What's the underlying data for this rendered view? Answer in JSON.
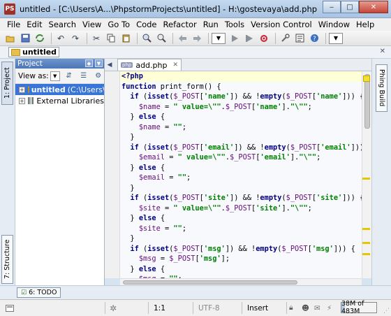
{
  "window": {
    "title": "untitled - [C:\\Users\\A...\\PhpstormProjects\\untitled] - H:\\gostevaya\\add.php - JetBrains PhpStorm ...",
    "app_icon": "PS",
    "controls": {
      "minimize": "‒",
      "maximize": "□",
      "close": "✕"
    }
  },
  "menu": [
    "File",
    "Edit",
    "Search",
    "View",
    "Go To",
    "Code",
    "Refactor",
    "Run",
    "Tools",
    "Version Control",
    "Window",
    "Help"
  ],
  "toolbar": {
    "icons": [
      "open-icon",
      "save-icon",
      "sync-icon",
      "undo-icon",
      "redo-icon",
      "cut-icon",
      "copy-icon",
      "paste-icon",
      "find-icon",
      "replace-icon",
      "back-icon",
      "forward-icon",
      "run-config-dropdown",
      "run-icon",
      "debug-icon",
      "stop-icon",
      "settings-icon",
      "structure-icon",
      "help-icon",
      "more-dropdown"
    ]
  },
  "navbar": {
    "crumb": "untitled"
  },
  "left_strip": {
    "project_tab": "1: Project",
    "structure_tab": "7: Structure"
  },
  "project": {
    "header": "Project",
    "view_as_label": "View as:",
    "tree": [
      {
        "name": "untitled",
        "path": "(C:\\Users\\A",
        "selected": true
      },
      {
        "name": "External Libraries",
        "selected": false
      }
    ]
  },
  "editor": {
    "tab": {
      "icon": "php",
      "label": "add.php"
    },
    "lines": [
      [
        {
          "t": "<?php",
          "c": "tag"
        }
      ],
      [
        {
          "t": "function ",
          "c": "kw"
        },
        {
          "t": "print_form",
          "c": "fn"
        },
        {
          "t": "() {",
          "c": ""
        }
      ],
      [
        {
          "t": "  if ",
          "c": "kw"
        },
        {
          "t": "(",
          "c": ""
        },
        {
          "t": "isset",
          "c": "kw"
        },
        {
          "t": "(",
          "c": ""
        },
        {
          "t": "$_POST",
          "c": "var"
        },
        {
          "t": "[",
          "c": ""
        },
        {
          "t": "'name'",
          "c": "str"
        },
        {
          "t": "]) && !",
          "c": ""
        },
        {
          "t": "empty",
          "c": "kw"
        },
        {
          "t": "(",
          "c": ""
        },
        {
          "t": "$_POST",
          "c": "var"
        },
        {
          "t": "[",
          "c": ""
        },
        {
          "t": "'name'",
          "c": "str"
        },
        {
          "t": "])) {",
          "c": ""
        }
      ],
      [
        {
          "t": "    ",
          "c": ""
        },
        {
          "t": "$name",
          "c": "var"
        },
        {
          "t": " = ",
          "c": ""
        },
        {
          "t": "\" value=\\\"\"",
          "c": "str"
        },
        {
          "t": ".",
          "c": ""
        },
        {
          "t": "$_POST",
          "c": "var"
        },
        {
          "t": "[",
          "c": ""
        },
        {
          "t": "'name'",
          "c": "str"
        },
        {
          "t": "].",
          "c": ""
        },
        {
          "t": "\"\\\"\"",
          "c": "str"
        },
        {
          "t": ";",
          "c": ""
        }
      ],
      [
        {
          "t": "  } ",
          "c": ""
        },
        {
          "t": "else",
          "c": "kw"
        },
        {
          "t": " {",
          "c": ""
        }
      ],
      [
        {
          "t": "    ",
          "c": ""
        },
        {
          "t": "$name",
          "c": "var"
        },
        {
          "t": " = ",
          "c": ""
        },
        {
          "t": "\"\"",
          "c": "str"
        },
        {
          "t": ";",
          "c": ""
        }
      ],
      [
        {
          "t": "  }",
          "c": ""
        }
      ],
      [
        {
          "t": "  if ",
          "c": "kw"
        },
        {
          "t": "(",
          "c": ""
        },
        {
          "t": "isset",
          "c": "kw"
        },
        {
          "t": "(",
          "c": ""
        },
        {
          "t": "$_POST",
          "c": "var"
        },
        {
          "t": "[",
          "c": ""
        },
        {
          "t": "'email'",
          "c": "str"
        },
        {
          "t": "]) && !",
          "c": ""
        },
        {
          "t": "empty",
          "c": "kw"
        },
        {
          "t": "(",
          "c": ""
        },
        {
          "t": "$_POST",
          "c": "var"
        },
        {
          "t": "[",
          "c": ""
        },
        {
          "t": "'email'",
          "c": "str"
        },
        {
          "t": "])) {",
          "c": ""
        }
      ],
      [
        {
          "t": "    ",
          "c": ""
        },
        {
          "t": "$email",
          "c": "var"
        },
        {
          "t": " = ",
          "c": ""
        },
        {
          "t": "\" value=\\\"\"",
          "c": "str"
        },
        {
          "t": ".",
          "c": ""
        },
        {
          "t": "$_POST",
          "c": "var"
        },
        {
          "t": "[",
          "c": ""
        },
        {
          "t": "'email'",
          "c": "str"
        },
        {
          "t": "].",
          "c": ""
        },
        {
          "t": "\"\\\"\"",
          "c": "str"
        },
        {
          "t": ";",
          "c": ""
        }
      ],
      [
        {
          "t": "  } ",
          "c": ""
        },
        {
          "t": "else",
          "c": "kw"
        },
        {
          "t": " {",
          "c": ""
        }
      ],
      [
        {
          "t": "    ",
          "c": ""
        },
        {
          "t": "$email",
          "c": "var"
        },
        {
          "t": " = ",
          "c": ""
        },
        {
          "t": "\"\"",
          "c": "str"
        },
        {
          "t": ";",
          "c": ""
        }
      ],
      [
        {
          "t": "  }",
          "c": ""
        }
      ],
      [
        {
          "t": "  if ",
          "c": "kw"
        },
        {
          "t": "(",
          "c": ""
        },
        {
          "t": "isset",
          "c": "kw"
        },
        {
          "t": "(",
          "c": ""
        },
        {
          "t": "$_POST",
          "c": "var"
        },
        {
          "t": "[",
          "c": ""
        },
        {
          "t": "'site'",
          "c": "str"
        },
        {
          "t": "]) && !",
          "c": ""
        },
        {
          "t": "empty",
          "c": "kw"
        },
        {
          "t": "(",
          "c": ""
        },
        {
          "t": "$_POST",
          "c": "var"
        },
        {
          "t": "[",
          "c": ""
        },
        {
          "t": "'site'",
          "c": "str"
        },
        {
          "t": "])) {",
          "c": ""
        }
      ],
      [
        {
          "t": "    ",
          "c": ""
        },
        {
          "t": "$site",
          "c": "var"
        },
        {
          "t": " = ",
          "c": ""
        },
        {
          "t": "\" value=\\\"\"",
          "c": "str"
        },
        {
          "t": ".",
          "c": ""
        },
        {
          "t": "$_POST",
          "c": "var"
        },
        {
          "t": "[",
          "c": ""
        },
        {
          "t": "'site'",
          "c": "str"
        },
        {
          "t": "].",
          "c": ""
        },
        {
          "t": "\"\\\"\"",
          "c": "str"
        },
        {
          "t": ";",
          "c": ""
        }
      ],
      [
        {
          "t": "  } ",
          "c": ""
        },
        {
          "t": "else",
          "c": "kw"
        },
        {
          "t": " {",
          "c": ""
        }
      ],
      [
        {
          "t": "    ",
          "c": ""
        },
        {
          "t": "$site",
          "c": "var"
        },
        {
          "t": " = ",
          "c": ""
        },
        {
          "t": "\"\"",
          "c": "str"
        },
        {
          "t": ";",
          "c": ""
        }
      ],
      [
        {
          "t": "  }",
          "c": ""
        }
      ],
      [
        {
          "t": "  if ",
          "c": "kw"
        },
        {
          "t": "(",
          "c": ""
        },
        {
          "t": "isset",
          "c": "kw"
        },
        {
          "t": "(",
          "c": ""
        },
        {
          "t": "$_POST",
          "c": "var"
        },
        {
          "t": "[",
          "c": ""
        },
        {
          "t": "'msg'",
          "c": "str"
        },
        {
          "t": "]) && !",
          "c": ""
        },
        {
          "t": "empty",
          "c": "kw"
        },
        {
          "t": "(",
          "c": ""
        },
        {
          "t": "$_POST",
          "c": "var"
        },
        {
          "t": "[",
          "c": ""
        },
        {
          "t": "'msg'",
          "c": "str"
        },
        {
          "t": "])) {",
          "c": ""
        }
      ],
      [
        {
          "t": "    ",
          "c": ""
        },
        {
          "t": "$msg",
          "c": "var"
        },
        {
          "t": " = ",
          "c": ""
        },
        {
          "t": "$_POST",
          "c": "var"
        },
        {
          "t": "[",
          "c": ""
        },
        {
          "t": "'msg'",
          "c": "str"
        },
        {
          "t": "];",
          "c": ""
        }
      ],
      [
        {
          "t": "  } ",
          "c": ""
        },
        {
          "t": "else",
          "c": "kw"
        },
        {
          "t": " {",
          "c": ""
        }
      ],
      [
        {
          "t": "    ",
          "c": ""
        },
        {
          "t": "$msg",
          "c": "var"
        },
        {
          "t": " = ",
          "c": ""
        },
        {
          "t": "\"\"",
          "c": "str"
        },
        {
          "t": ";",
          "c": ""
        }
      ]
    ]
  },
  "right_strip": {
    "tab": "Phing Build"
  },
  "bottom_strip": {
    "todo_tab": "6: TODO"
  },
  "status": {
    "position": "1:1",
    "encoding": "UTF-8",
    "insert_mode": "Insert",
    "memory": "38M of 483M"
  },
  "colors": {
    "keyword": "#000080",
    "variable": "#660e7a",
    "string": "#008000",
    "selection": "#3875d7",
    "marker": "#e3c800"
  }
}
